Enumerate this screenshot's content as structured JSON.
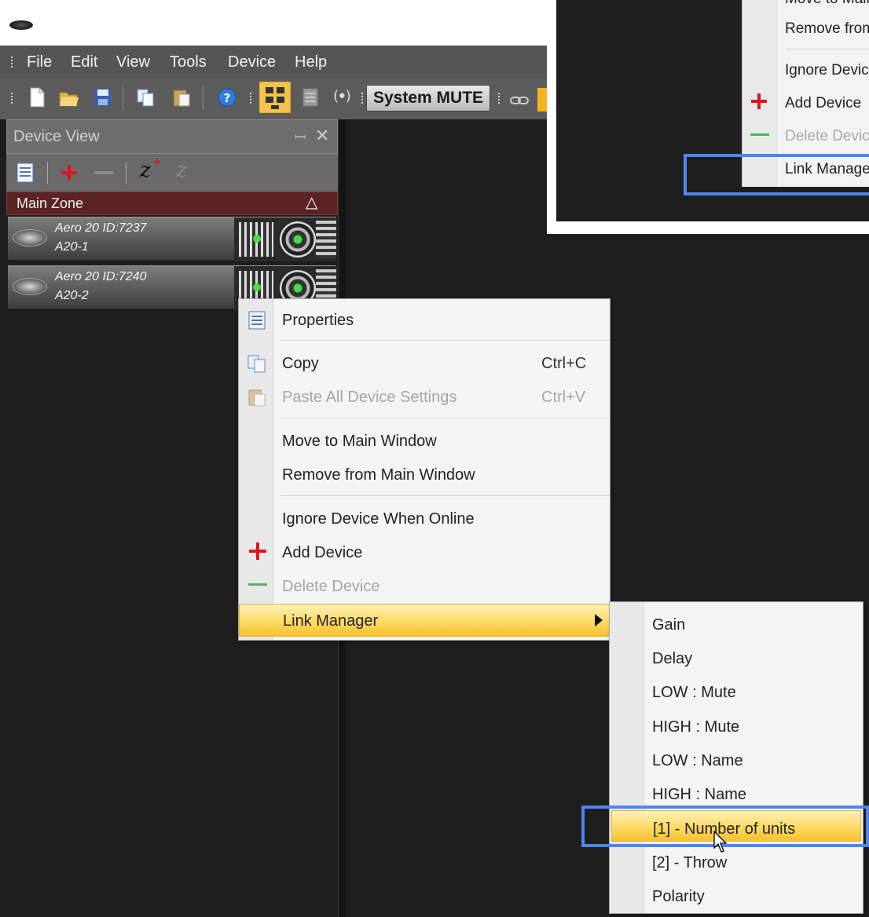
{
  "menubar": {
    "items": [
      "File",
      "Edit",
      "View",
      "Tools",
      "Device",
      "Help"
    ]
  },
  "toolbar": {
    "system_mute_label": "System MUTE",
    "icons": [
      "new-file-icon",
      "open-folder-icon",
      "save-icon",
      "copy-icon",
      "paste-icon",
      "help-icon",
      "device-view-icon",
      "list-icon",
      "broadcast-icon",
      "link-icon"
    ]
  },
  "device_view": {
    "title": "Device View",
    "pin_glyph": "📌",
    "close_glyph": "✕",
    "zone_name": "Main Zone",
    "zone_toggle": "△",
    "devices": [
      {
        "line1": "Aero 20  ID:7237",
        "line2": "A20-1"
      },
      {
        "line1": "Aero 20  ID:7240",
        "line2": "A20-2"
      }
    ]
  },
  "context_menu": {
    "items": [
      {
        "label": "Properties",
        "shortcut": "",
        "icon": "properties-icon",
        "disabled": false
      },
      {
        "label": "Copy",
        "shortcut": "Ctrl+C",
        "icon": "copy-icon",
        "disabled": false
      },
      {
        "label": "Paste All Device Settings",
        "shortcut": "Ctrl+V",
        "icon": "paste-icon",
        "disabled": true
      },
      {
        "label": "Move to Main Window",
        "shortcut": "",
        "icon": "",
        "disabled": false
      },
      {
        "label": "Remove from Main Window",
        "shortcut": "",
        "icon": "",
        "disabled": false
      },
      {
        "label": "Ignore Device When Online",
        "shortcut": "",
        "icon": "",
        "disabled": false
      },
      {
        "label": "Add Device",
        "shortcut": "",
        "icon": "plus-icon",
        "disabled": false
      },
      {
        "label": "Delete Device",
        "shortcut": "",
        "icon": "minus-icon",
        "disabled": true
      },
      {
        "label": "Link Manager",
        "shortcut": "",
        "icon": "",
        "disabled": false,
        "highlighted": true,
        "has_submenu": true
      }
    ]
  },
  "submenu": {
    "items": [
      "Gain",
      "Delay",
      "LOW : Mute",
      "HIGH : Mute",
      "LOW : Name",
      "HIGH : Name",
      "[1] - Number of units",
      "[2] - Throw",
      "Polarity"
    ],
    "highlighted_index": 6
  },
  "inset": {
    "items": [
      {
        "label": "Move to Main",
        "disabled": false
      },
      {
        "label": "Remove from",
        "disabled": false
      },
      {
        "label": "Ignore Device",
        "disabled": false
      },
      {
        "label": "Add Device",
        "disabled": false
      },
      {
        "label": "Delete Device",
        "disabled": true
      },
      {
        "label": "Link Manager",
        "disabled": false
      }
    ]
  },
  "colors": {
    "highlight": "#ffdf73",
    "annotation": "#4d86f2",
    "zone_bar": "#5b2324",
    "add_red": "#e0141b",
    "delete_green": "#5ab35a"
  }
}
